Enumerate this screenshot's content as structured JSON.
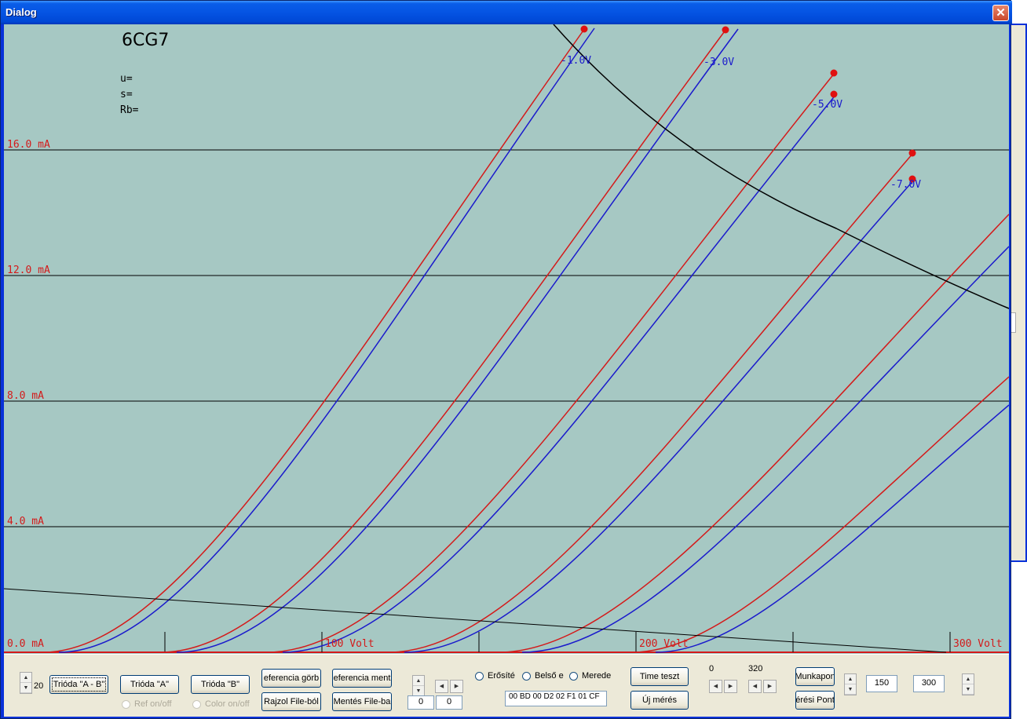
{
  "window": {
    "title": "Dialog",
    "close_glyph": "✕"
  },
  "plot": {
    "tube_name": "6CG7",
    "params": {
      "u": "u=",
      "s": "s=",
      "rb": "Rb="
    },
    "y_labels": [
      "16.0 mA",
      "12.0 mA",
      "8.0 mA",
      "4.0 mA",
      "0.0 mA"
    ],
    "x_labels": [
      "100 Volt",
      "200 Volt",
      "300 Volt"
    ],
    "curve_labels": [
      "-1.0V",
      "-3.0V",
      "-5.0V",
      "-7.0V"
    ],
    "colors": {
      "background": "#a6c8c3",
      "red": "#d41a1a",
      "blue": "#1a1acc",
      "grid": "#000000"
    }
  },
  "controls": {
    "spin_value": "20",
    "buttons": {
      "trioda_ab": "Trióda \"A - B\"",
      "trioda_a": "Trióda  \"A\"",
      "trioda_b": "Trióda  \"B\"",
      "ref_gorbe": "eferencia görb",
      "ref_mentes": "eferencia ment",
      "rajzol_file": "Rajzol File-ból",
      "mentes_file": "Mentés File-ba",
      "time_teszt": "Time teszt",
      "uj_meres": "Új mérés",
      "munkapont": "Munkapon",
      "meresi_pont": "érési Pont"
    },
    "checks": {
      "ref_onoff": "Ref on/off",
      "color_onoff": "Color on/off"
    },
    "radios": {
      "erosites": "Erősíté",
      "belso": "Belső e",
      "meredek": "Merede"
    },
    "fields": {
      "offset_a": "0",
      "offset_b": "0",
      "hex": "00 BD 00 D2 02 F1 01 CF",
      "v150": "150",
      "v300": "300"
    },
    "labels": {
      "zero": "0",
      "three20": "320"
    }
  }
}
